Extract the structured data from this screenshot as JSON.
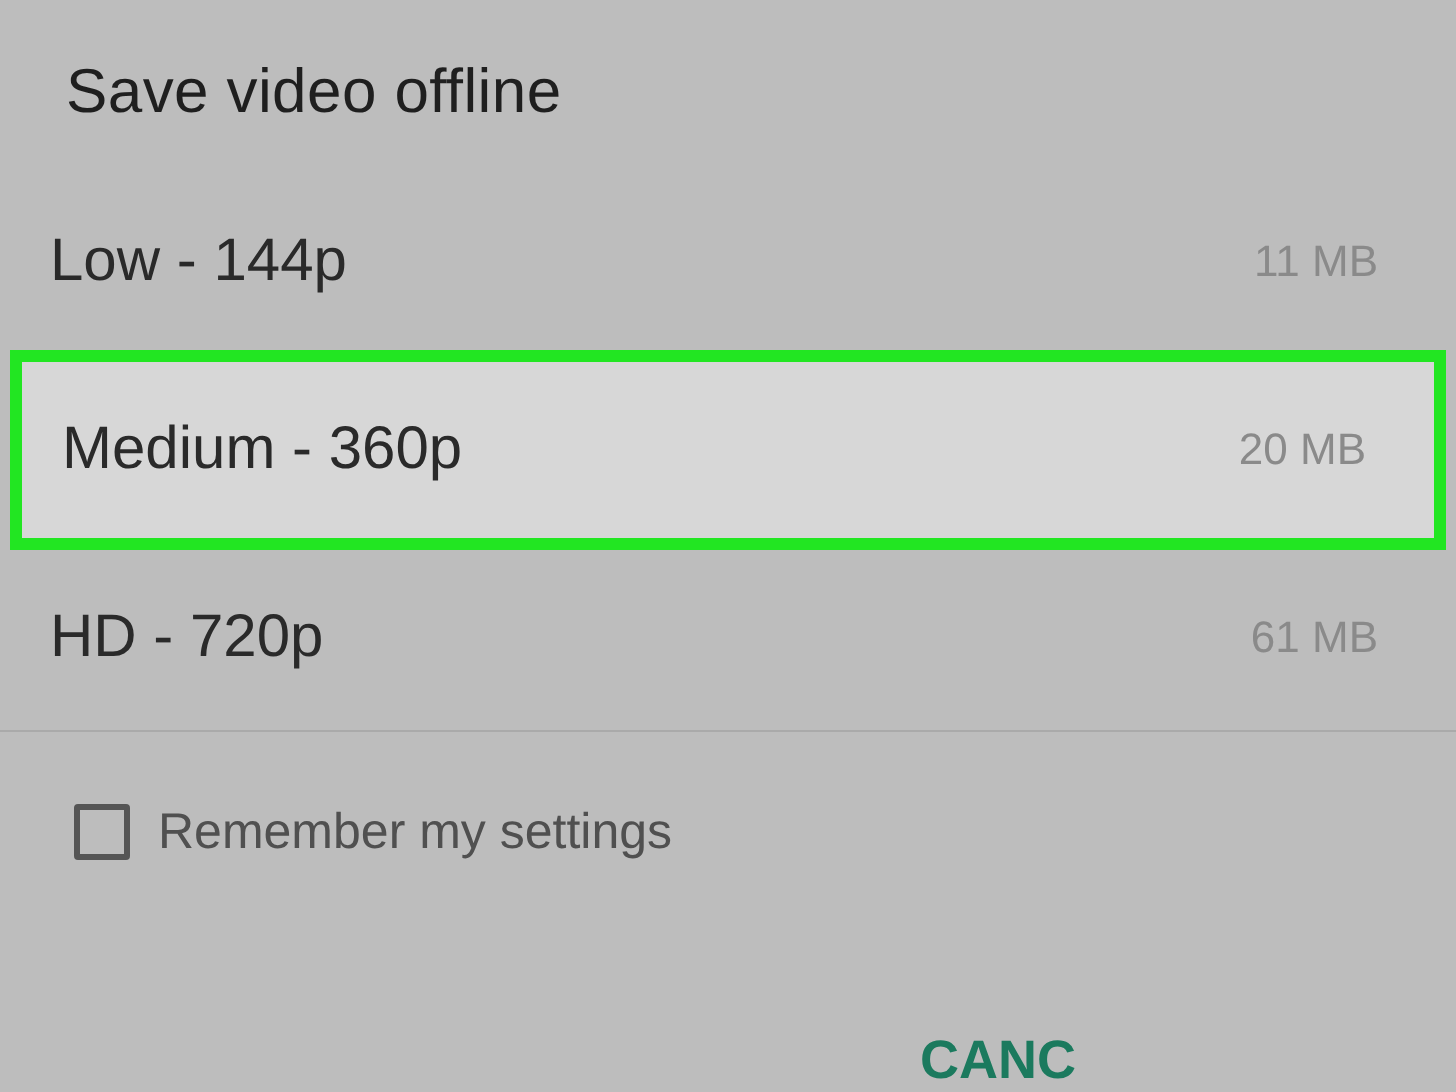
{
  "dialog": {
    "title": "Save video offline",
    "options": [
      {
        "label": "Low - 144p",
        "size": "11 MB",
        "selected": false
      },
      {
        "label": "Medium - 360p",
        "size": "20 MB",
        "selected": true
      },
      {
        "label": "HD - 720p",
        "size": "61 MB",
        "selected": false
      }
    ],
    "remember": {
      "label": "Remember my settings",
      "checked": false
    },
    "buttons": [
      "CANC"
    ]
  }
}
